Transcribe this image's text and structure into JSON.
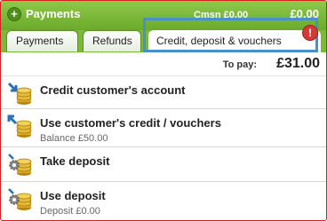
{
  "header": {
    "title": "Payments",
    "commission": "Cmsn £0.00",
    "total": "£0.00"
  },
  "tabs": [
    {
      "label": "Payments"
    },
    {
      "label": "Refunds"
    },
    {
      "label": "Credit, deposit & vouchers",
      "active": true
    }
  ],
  "alert": {
    "symbol": "!"
  },
  "to_pay": {
    "label": "To pay:",
    "amount": "£31.00"
  },
  "actions": [
    {
      "title": "Credit customer's account",
      "icon": "coins-arrow-in-icon"
    },
    {
      "title": "Use customer's credit / vouchers",
      "subtitle": "Balance £50.00",
      "icon": "coins-arrow-out-icon"
    },
    {
      "title": "Take deposit",
      "icon": "coins-gear-in-icon"
    },
    {
      "title": "Use deposit",
      "subtitle": "Deposit £0.00",
      "icon": "coins-gear-out-icon"
    }
  ],
  "colors": {
    "header_green": "#7cb93a",
    "highlight_blue": "#4a90c8",
    "frame_red": "#d21f1f",
    "alert_red": "#d23a3a"
  }
}
